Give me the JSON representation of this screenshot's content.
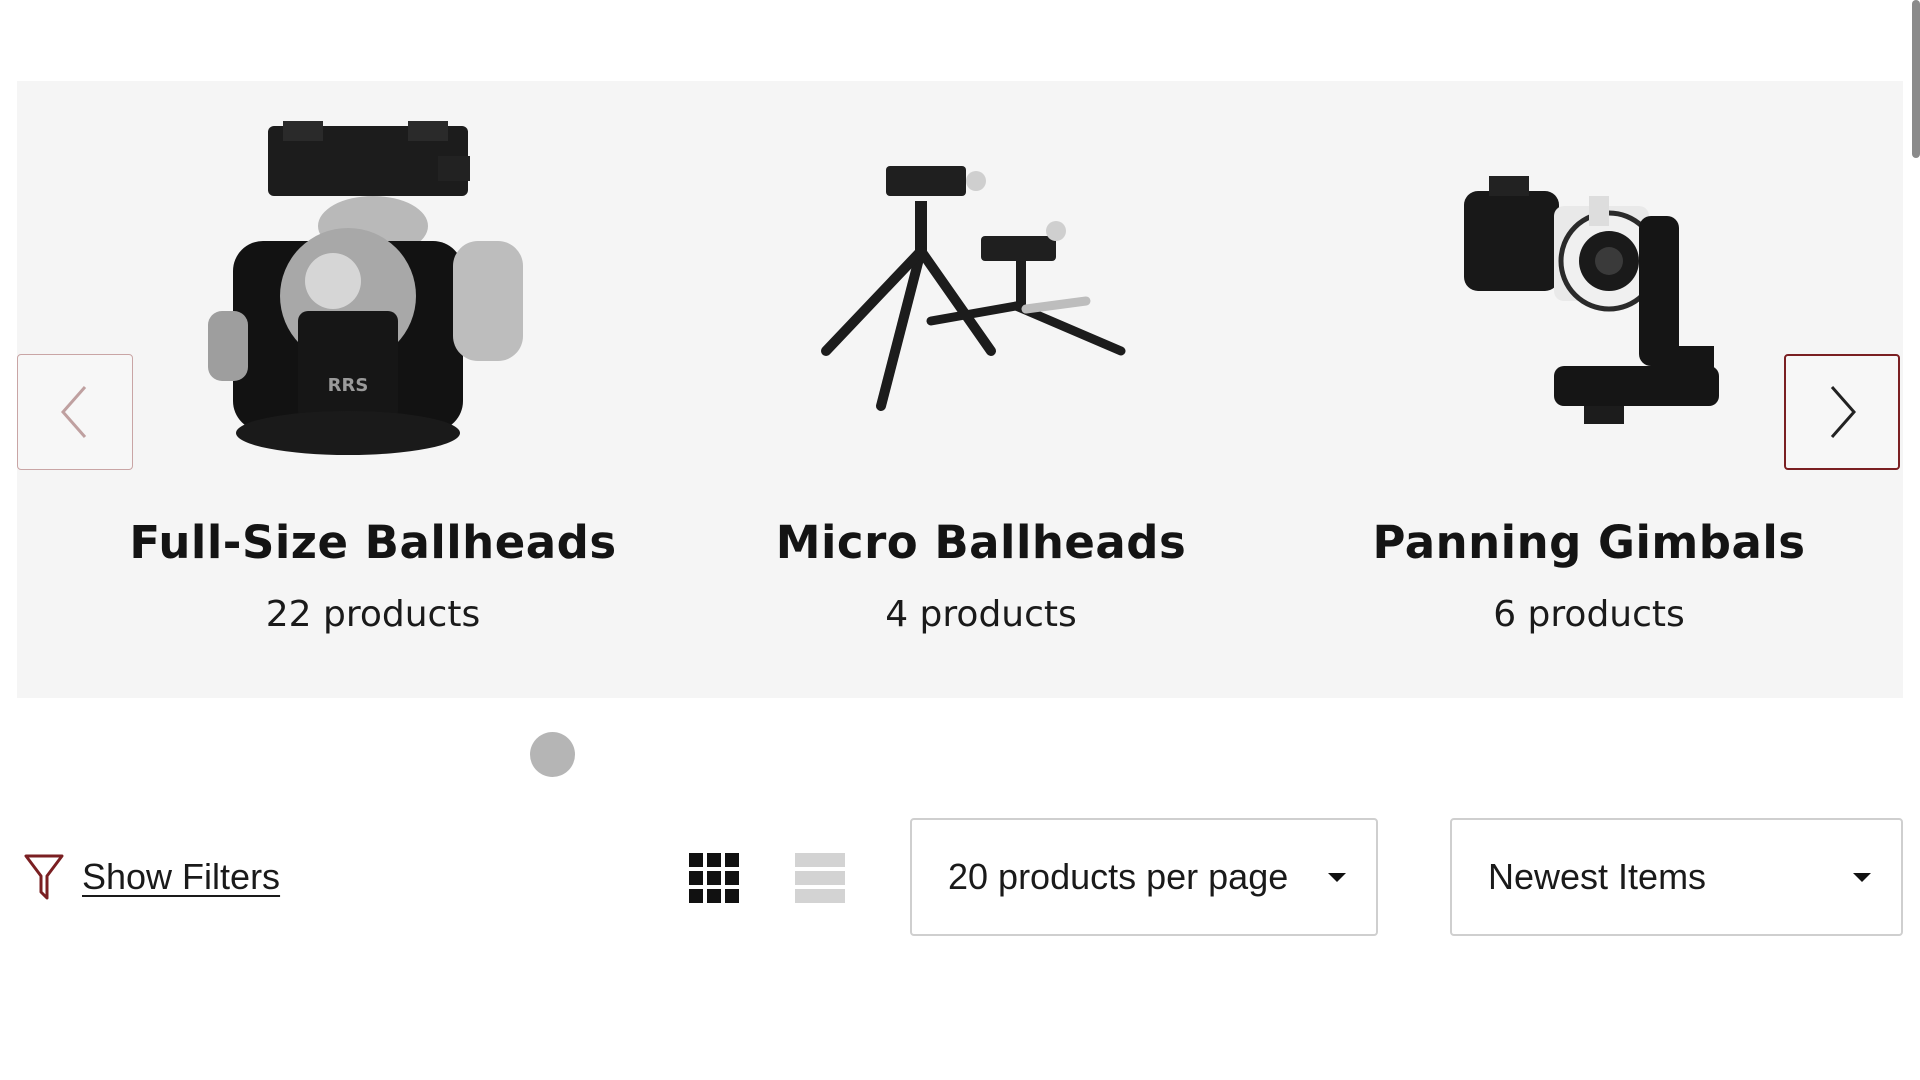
{
  "carousel": {
    "slides": [
      {
        "title": "Full-Size Ballheads",
        "count": "22 products",
        "image_icon": "ballhead-image"
      },
      {
        "title": "Micro Ballheads",
        "count": "4 products",
        "image_icon": "micro-tripod-image"
      },
      {
        "title": "Panning Gimbals",
        "count": "6 products",
        "image_icon": "gimbal-camera-image"
      }
    ],
    "prev_icon": "chevron-left-icon",
    "next_icon": "chevron-right-icon",
    "accent_color": "#7a1f22",
    "active_dot_color": "#b5b5b5"
  },
  "toolbar": {
    "filters_label": "Show Filters",
    "filter_icon": "funnel-icon",
    "grid_view_icon": "grid-view-icon",
    "list_view_icon": "list-view-icon",
    "per_page_value": "20 products per page",
    "sort_value": "Newest Items"
  }
}
